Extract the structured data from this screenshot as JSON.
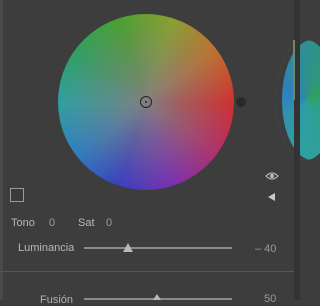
{
  "color_grading": {
    "hue_label": "Tono",
    "hue_value": "0",
    "saturation_label": "Sat",
    "saturation_value": "0",
    "luminance_label": "Luminancia",
    "luminance_value": "– 40",
    "luminance_fraction": 0.3,
    "blending_label": "Fusión",
    "blending_value": "50",
    "blending_fraction": 0.5
  },
  "icons": {
    "visibility": "eye-icon",
    "collapse": "triangle-left-icon",
    "swatch": "color-swatch"
  }
}
